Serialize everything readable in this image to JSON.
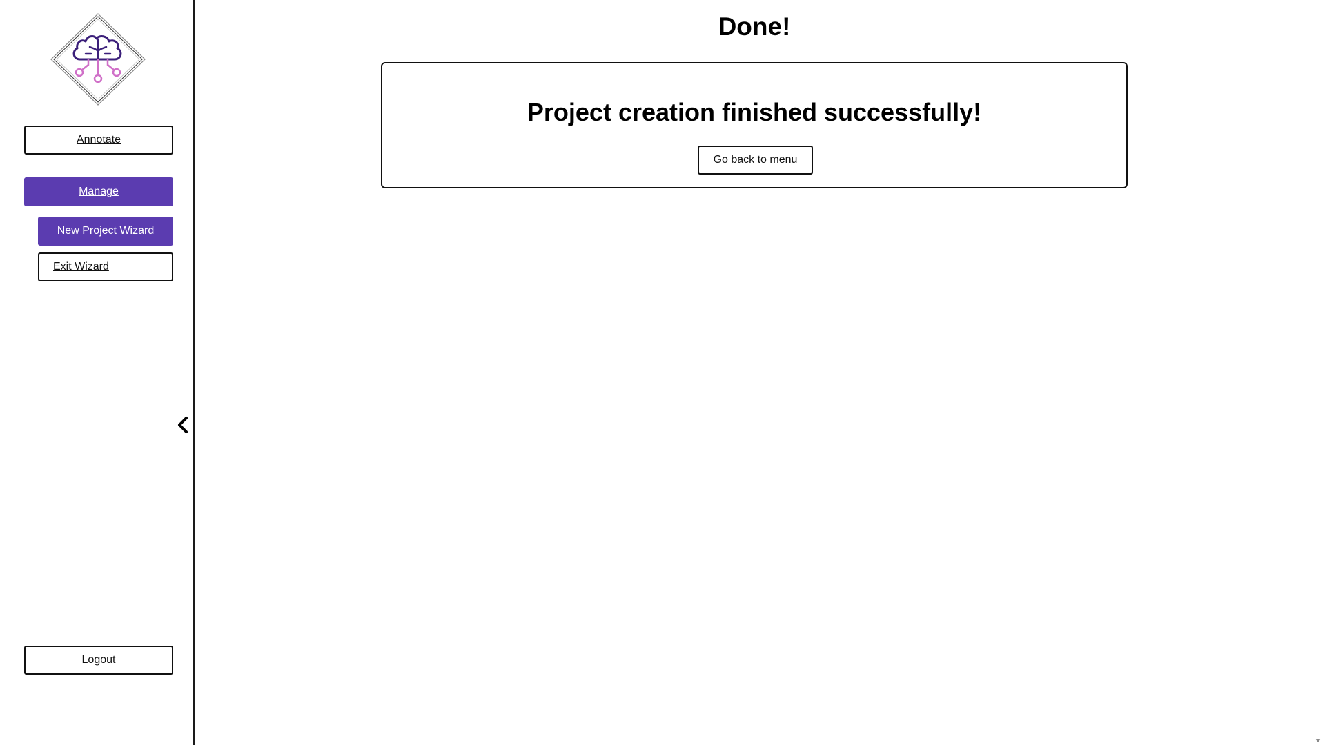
{
  "sidebar": {
    "logo_icon": "brain-circuit-icon",
    "annotate_label": "Annotate",
    "manage_label": "Manage",
    "new_project_wizard_label": "New Project Wizard",
    "exit_wizard_label": "Exit Wizard",
    "logout_label": "Logout",
    "collapse_icon": "chevron-left-icon",
    "active_color": "#5b3cb0"
  },
  "main": {
    "title": "Done!",
    "card": {
      "message": "Project creation finished successfully!",
      "button_label": "Go back to menu"
    }
  },
  "colors": {
    "logo_purple": "#3b1f7a",
    "logo_pink": "#d070c8",
    "accent": "#5b3cb0"
  }
}
